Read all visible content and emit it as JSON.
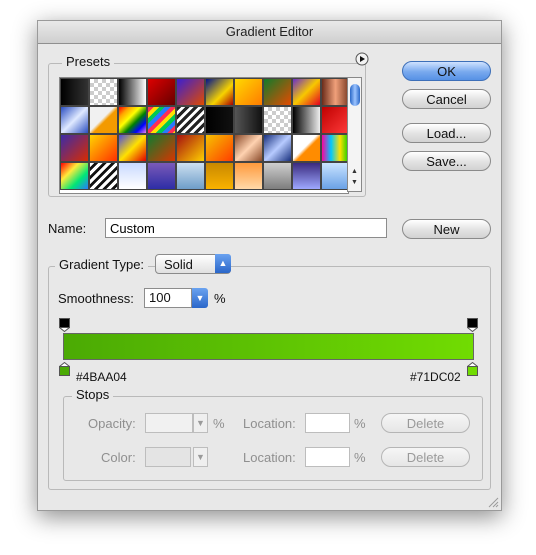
{
  "window": {
    "title": "Gradient Editor"
  },
  "presets": {
    "legend": "Presets",
    "swatches": [
      "linear-gradient(90deg,#000,#333)",
      "repeating-conic-gradient(#ccc 0 25%,#fff 0 50%) 0 0/8px 8px",
      "linear-gradient(90deg,#000,#fff)",
      "linear-gradient(135deg,#d00,#600)",
      "linear-gradient(135deg,#3a1fd1,#e04a00)",
      "linear-gradient(135deg,#00138c,#f7d300 60%,#a70000)",
      "linear-gradient(135deg,#ffd900,#ff7b00)",
      "linear-gradient(135deg,#117a2a,#e54b00)",
      "linear-gradient(135deg,#6a2fc9,#f7c800,#e30022)",
      "linear-gradient(90deg,#6b2c1a,#f0a07a,#7a3a22)",
      "linear-gradient(135deg,#2a4ec2,#dfe9ff 50%,#2a4ec2)",
      "linear-gradient(135deg,#f1f1f1 45%,#f39a00 55%)",
      "linear-gradient(135deg,red,orange,yellow,green,blue,violet)",
      "repeating-linear-gradient(135deg,#ff2d55 0 4px,#ffe100 4px 8px,#00c853 8px 12px,#2979ff 12px 16px)",
      "repeating-linear-gradient(135deg,#222 0 3px,#fff 3px 6px)",
      "linear-gradient(90deg,#000,#111)",
      "linear-gradient(90deg,#555,#111)",
      "repeating-conic-gradient(#ccc 0 25%,#fff 0 50%) 0 0/8px 8px",
      "linear-gradient(90deg,#000,#eee)",
      "linear-gradient(135deg,#c00000,#ff3b3b)",
      "linear-gradient(135deg,#3b2ba8,#d92b00)",
      "linear-gradient(135deg,#ffd400,#ff3000)",
      "linear-gradient(135deg,#4c4ce0,#ffe100 50%,#e00000)",
      "linear-gradient(135deg,#0f7b2e,#d73500)",
      "linear-gradient(135deg,#a51010,#ffd000)",
      "linear-gradient(135deg,#f6c200,#ff3d00)",
      "linear-gradient(135deg,#8a4a2a,#ffd2b0,#8a4a2a)",
      "linear-gradient(135deg,#18307e,#b7cbff 50%,#18307e)",
      "linear-gradient(135deg,#fff 45%,#ff8c00 55%)",
      "linear-gradient(90deg,#ff00a0,#00c8ff,#ffe000,#00d000)",
      "linear-gradient(135deg,#ff0000,#ffeb3b,#00e676,#2979ff)",
      "repeating-linear-gradient(135deg,#fff 0 3px,#111 3px 6px)",
      "linear-gradient(#c9d9ff,#ffffff)",
      "linear-gradient(#7a5ab8,#2d2da6)",
      "linear-gradient(#cde0f0,#6e9dc9)",
      "linear-gradient(#c98800,#f9b200)",
      "linear-gradient(#ff9a3c,#ffd9a8)",
      "linear-gradient(#cfcfcf,#7d7d7d)",
      "linear-gradient(#3a2a7e,#9ea8ff)",
      "linear-gradient(#c9e3ff,#6aa1e6)"
    ]
  },
  "buttons": {
    "ok": "OK",
    "cancel": "Cancel",
    "load": "Load...",
    "save": "Save...",
    "new": "New",
    "delete_opacity": "Delete",
    "delete_color": "Delete"
  },
  "name": {
    "label": "Name:",
    "value": "Custom"
  },
  "gradient_type": {
    "label": "Gradient Type:",
    "value": "Solid"
  },
  "smoothness": {
    "label": "Smoothness:",
    "value": "100",
    "unit": "%"
  },
  "gradient": {
    "start_color": "#4BAA04",
    "end_color": "#71DC02",
    "start_label": "#4BAA04",
    "end_label": "#71DC02"
  },
  "stops": {
    "legend": "Stops",
    "opacity_label": "Opacity:",
    "opacity_unit": "%",
    "opacity_location_label": "Location:",
    "opacity_location_unit": "%",
    "color_label": "Color:",
    "color_location_label": "Location:",
    "color_location_unit": "%"
  }
}
